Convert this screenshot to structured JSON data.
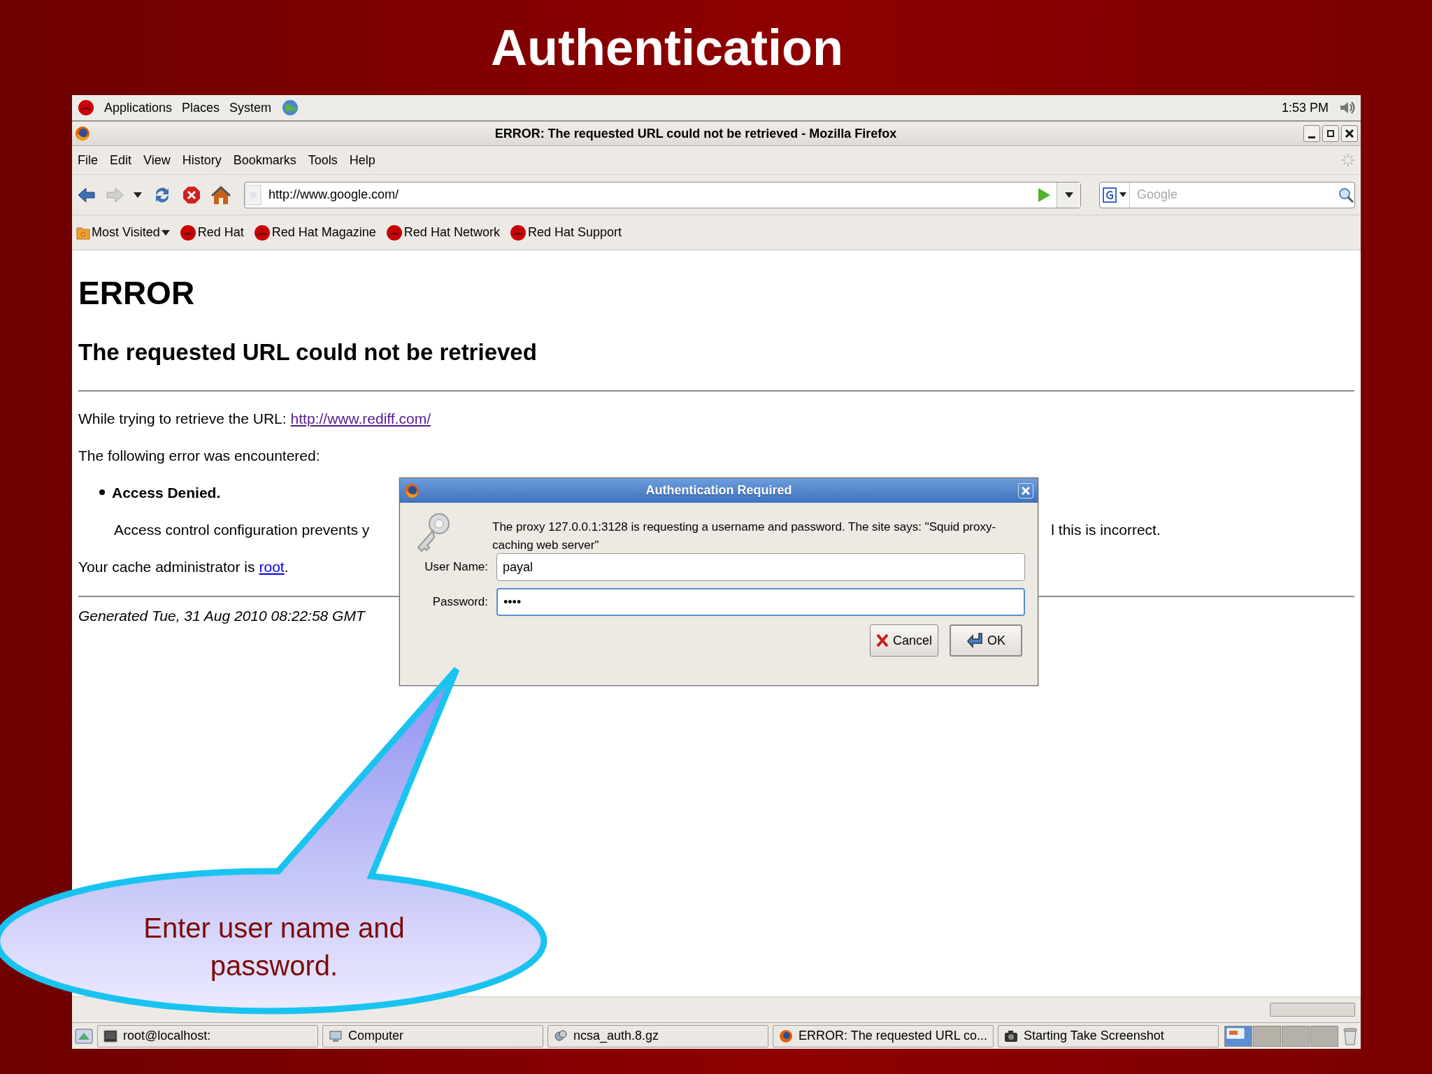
{
  "slide": {
    "title": "Authentication"
  },
  "top_panel": {
    "menus": [
      "Applications",
      "Places",
      "System"
    ],
    "clock": "1:53 PM"
  },
  "window": {
    "title": "ERROR: The requested URL could not be retrieved - Mozilla Firefox"
  },
  "menubar": [
    {
      "label": "File"
    },
    {
      "label": "Edit"
    },
    {
      "label": "View"
    },
    {
      "label": "History"
    },
    {
      "label": "Bookmarks"
    },
    {
      "label": "Tools"
    },
    {
      "label": "Help"
    }
  ],
  "toolbar": {
    "url": "http://www.google.com/",
    "search_placeholder": "Google"
  },
  "bookmarks": [
    {
      "label": "Most Visited",
      "kind": "folder"
    },
    {
      "label": "Red Hat",
      "kind": "link"
    },
    {
      "label": "Red Hat Magazine",
      "kind": "link"
    },
    {
      "label": "Red Hat Network",
      "kind": "link"
    },
    {
      "label": "Red Hat Support",
      "kind": "link"
    }
  ],
  "page": {
    "heading": "ERROR",
    "subheading": "The requested URL could not be retrieved",
    "url_line": {
      "text": "While trying to retrieve the URL:",
      "link": "http://www.rediff.com/",
      "visited": true
    },
    "error_intro": "The following error was encountered:",
    "error_item": "Access Denied.",
    "explanation": [
      "Access control configuration prevents y",
      "l this is incorrect."
    ],
    "admin_line": {
      "text": "Your cache administrator is",
      "link": "root",
      "visited": false,
      "suffix": "."
    },
    "generated": "Generated Tue, 31 Aug 2010 08:22:58 GMT"
  },
  "dialog": {
    "title": "Authentication Required",
    "message": "The proxy 127.0.0.1:3128 is requesting a username and password. The site says: \"Squid proxy-caching web server\"",
    "fields": [
      {
        "label": "User Name:",
        "value": "payal",
        "focused": false
      },
      {
        "label": "Password:",
        "value": "••••",
        "focused": true
      }
    ],
    "buttons": [
      {
        "label": "Cancel",
        "kind": "cancel"
      },
      {
        "label": "OK",
        "kind": "ok"
      }
    ]
  },
  "status_bar": {
    "level": 0
  },
  "taskbar": [
    {
      "label": "root@localhost:",
      "kind": "terminal"
    },
    {
      "label": "Computer",
      "kind": "computer"
    },
    {
      "label": "ncsa_auth.8.gz",
      "kind": "file"
    },
    {
      "label": "ERROR: The requested URL co...",
      "kind": "browser"
    },
    {
      "label": "Starting Take Screenshot",
      "kind": "camera"
    }
  ],
  "callout": {
    "text": "Enter user name and password."
  }
}
